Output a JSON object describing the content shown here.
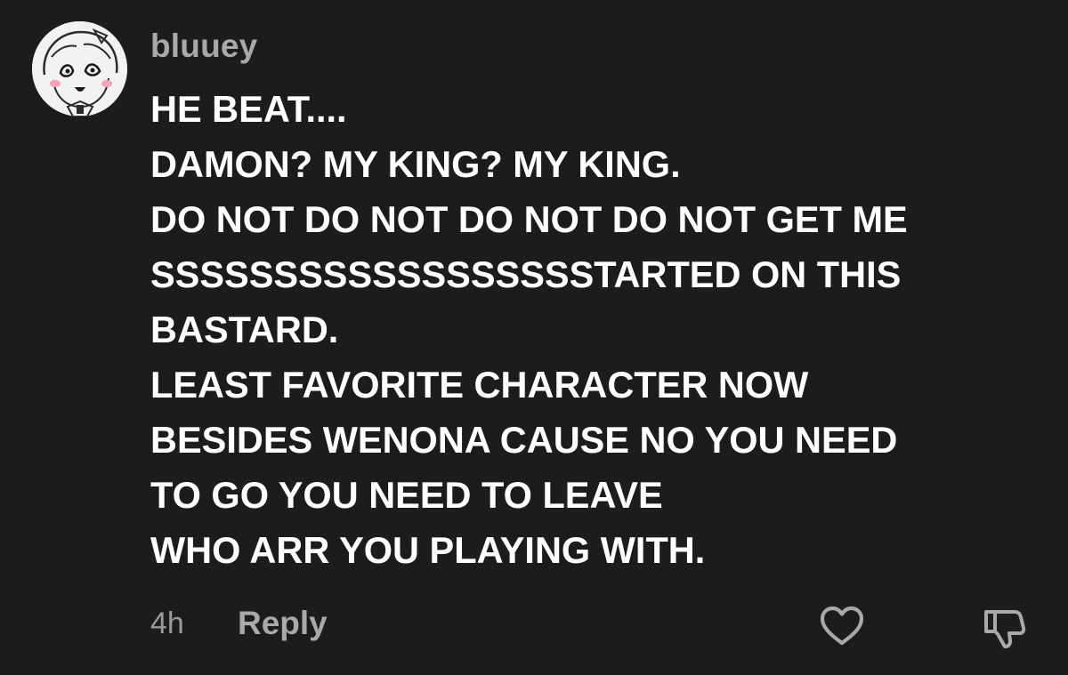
{
  "comment": {
    "username": "bluuey",
    "lines": [
      "HE BEAT....",
      "DAMON? MY KING? MY KING.",
      "DO NOT DO NOT DO NOT DO NOT GET ME",
      "SSSSSSSSSSSSSSSSSSTARTED ON THIS",
      "BASTARD.",
      "LEAST FAVORITE CHARACTER NOW",
      "BESIDES WENONA CAUSE NO YOU NEED",
      "TO GO YOU NEED TO LEAVE",
      "WHO ARR YOU PLAYING WITH."
    ],
    "timestamp": "4h",
    "reply_label": "Reply",
    "icons": {
      "like": "heart-outline-icon",
      "dislike": "thumbs-down-outline-icon"
    }
  },
  "colors": {
    "background": "#1c1c1c",
    "text": "#ffffff",
    "muted": "#a9a9a9"
  }
}
